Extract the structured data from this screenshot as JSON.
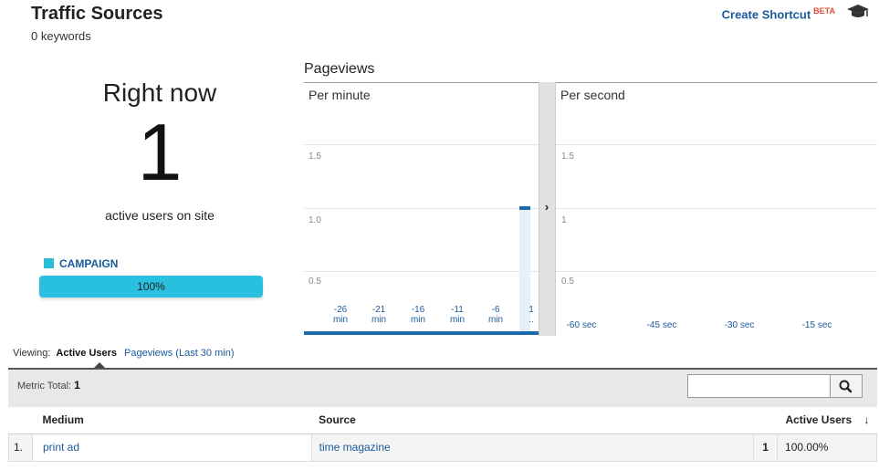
{
  "header": {
    "title": "Traffic Sources",
    "subtitle": "0 keywords",
    "shortcut_label": "Create Shortcut",
    "beta_label": "BETA",
    "cap_icon": "graduation-cap-icon"
  },
  "realtime": {
    "right_now_label": "Right now",
    "active_count": "1",
    "active_label": "active users on site",
    "legend_label": "CAMPAIGN",
    "legend_color": "#2bbcd8",
    "bar_value": 1.0,
    "bar_label": "100%"
  },
  "pageviews": {
    "title": "Pageviews",
    "per_minute": {
      "label": "Per minute",
      "yticks": [
        "1.5",
        "1.0",
        "0.5"
      ],
      "xticks": [
        {
          "top": "-26",
          "bottom": "min"
        },
        {
          "top": "-21",
          "bottom": "min"
        },
        {
          "top": "-16",
          "bottom": "min"
        },
        {
          "top": "-11",
          "bottom": "min"
        },
        {
          "top": "-6",
          "bottom": "min"
        },
        {
          "top": "1",
          "bottom": ".."
        }
      ],
      "last_bar_value": 1
    },
    "per_second": {
      "label": "Per second",
      "yticks": [
        "1.5",
        "1",
        "0.5"
      ],
      "xticks": [
        "-60 sec",
        "-45 sec",
        "-30 sec",
        "-15 sec"
      ]
    },
    "accent_color": "#1a6ab0"
  },
  "viewing": {
    "label": "Viewing:",
    "active_tab": "Active Users",
    "other_tab": "Pageviews (Last 30 min)"
  },
  "metric": {
    "label": "Metric Total:",
    "total": "1",
    "search_value": ""
  },
  "table": {
    "headers": [
      "Medium",
      "Source",
      "Active Users"
    ],
    "rows": [
      {
        "index": "1.",
        "medium": "print ad",
        "source": "time magazine",
        "users": "1",
        "percent": "100.00%"
      }
    ]
  }
}
